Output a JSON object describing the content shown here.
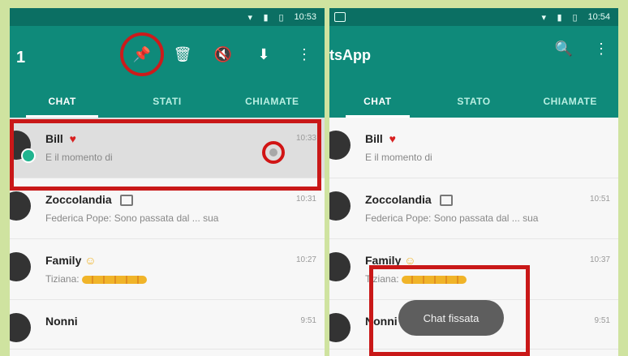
{
  "left_panel": {
    "status_time": "10:53",
    "toolbar": {
      "count_label": "1",
      "actions": [
        {
          "icon": "pin-icon"
        },
        {
          "icon": "delete-icon"
        },
        {
          "icon": "mute-icon"
        },
        {
          "icon": "archive-icon"
        },
        {
          "icon": "more-vert-icon"
        }
      ]
    },
    "tabs": [
      "CHAT",
      "STATI",
      "CHIAMATE"
    ],
    "chats": [
      {
        "name": "Bill",
        "time": "10:33",
        "preview": "E il momento di"
      },
      {
        "name": "Zoccolandia",
        "time": "10:31",
        "preview": "Federica Pope: Sono passata dal ... sua"
      },
      {
        "name": "Family",
        "time": "10:27",
        "preview": "Tiziana:"
      },
      {
        "name": "Nonni",
        "time": "9:51",
        "preview": ""
      }
    ]
  },
  "right_panel": {
    "status_time": "10:54",
    "toolbar": {
      "title": "tsApp",
      "actions": [
        {
          "icon": "search-icon"
        },
        {
          "icon": "more-vert-icon"
        }
      ]
    },
    "tabs": [
      "CHAT",
      "STATO",
      "CHIAMATE"
    ],
    "chats": [
      {
        "name": "Bill",
        "time": "",
        "preview": "E il momento di"
      },
      {
        "name": "Zoccolandia",
        "time": "10:51",
        "preview": "Federica Pope: Sono passata dal ... sua"
      },
      {
        "name": "Family",
        "time": "10:37",
        "preview": "Tiziana:"
      },
      {
        "name": "Nonni",
        "time": "9:51",
        "preview": ""
      }
    ],
    "toast": "Chat fissata"
  },
  "colors": {
    "teal": "#0f8a7a",
    "teal_dark": "#0b6f63",
    "highlight_red": "#c91818"
  }
}
